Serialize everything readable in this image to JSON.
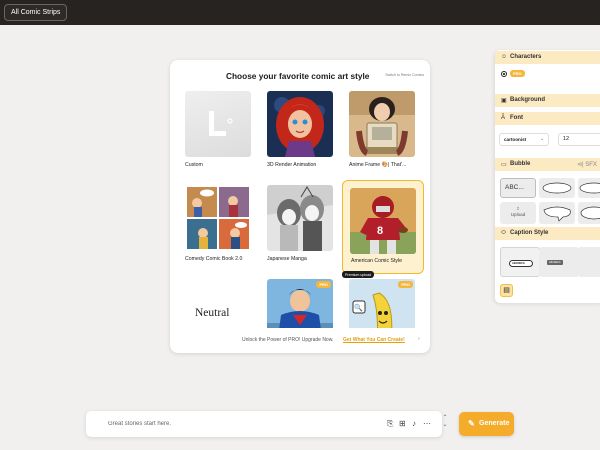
{
  "topbar": {
    "all_comic_strips": "All Comic Strips"
  },
  "modal": {
    "title": "Choose your favorite comic art style",
    "switch_link": "Switch to Remix Comics",
    "styles": [
      {
        "label": "Custom",
        "icon": "custom-l-icon"
      },
      {
        "label": "3D Render Animation"
      },
      {
        "label": "Anime Frame 🎨| That'..."
      },
      {
        "label": "Comedy Comic Book 2.0"
      },
      {
        "label": "Japanese Manga"
      },
      {
        "label": "American Comic Style",
        "selected": true
      },
      {
        "label": "Neutral"
      },
      {
        "label": "",
        "badge": "PRO"
      },
      {
        "label": "",
        "badge": "PRO",
        "tooltip": "Premium upload"
      }
    ],
    "pro_badge": "PRO",
    "upsell_text": "Unlock the Power of PRO! Upgrade Now.",
    "upsell_link": "Get What You Can Create!",
    "upsell_arrow": "›"
  },
  "panel": {
    "characters": "Characters",
    "pro_chip": "PRO",
    "background": "Background",
    "font": "Font",
    "font_value": "cartoonist",
    "font_size": "12",
    "bubble": "Bubble",
    "sfx": "SFX",
    "bubble_first": "ABC...",
    "upload": "Upload",
    "caption_style": "Caption Style",
    "caption_pill": "ABCDEFG",
    "caption_box": "ABCDEFG"
  },
  "prompt": {
    "placeholder": "Great stories start here.",
    "generate": "Generate"
  },
  "colors": {
    "accent": "#f6ac2b",
    "topbar": "#262320",
    "section_header": "#fbeac2"
  }
}
